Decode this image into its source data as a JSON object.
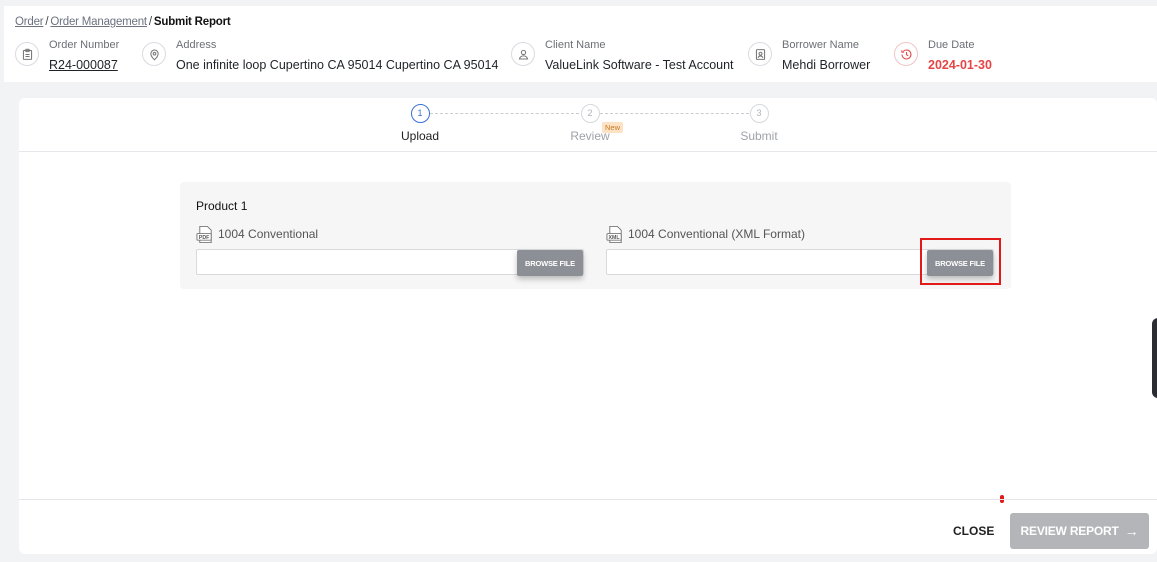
{
  "breadcrumb": {
    "items": [
      "Order",
      "Order Management"
    ],
    "separator": "/",
    "current": "Submit Report"
  },
  "order_info": {
    "order_number": {
      "label": "Order Number",
      "value": "R24-000087",
      "icon": "clipboard-icon"
    },
    "address": {
      "label": "Address",
      "value": "One infinite loop Cupertino CA 95014 Cupertino CA 95014",
      "icon": "location-pin-icon"
    },
    "client_name": {
      "label": "Client Name",
      "value": "ValueLink Software - Test Account",
      "icon": "user-icon"
    },
    "borrower_name": {
      "label": "Borrower Name",
      "value": "Mehdi Borrower",
      "icon": "id-badge-icon"
    },
    "due_date": {
      "label": "Due Date",
      "value": "2024-01-30",
      "icon": "clock-history-icon",
      "color": "#e64545"
    }
  },
  "stepper": {
    "steps": [
      {
        "number": "1",
        "label": "Upload",
        "active": true
      },
      {
        "number": "2",
        "label": "Review",
        "badge": "New"
      },
      {
        "number": "3",
        "label": "Submit"
      }
    ]
  },
  "product": {
    "title": "Product 1",
    "fields": [
      {
        "label": "1004 Conventional",
        "icon": "pdf-file-icon",
        "icon_text": "PDF",
        "button": "BROWSE FILE",
        "value": ""
      },
      {
        "label": "1004 Conventional (XML Format)",
        "icon": "xml-file-icon",
        "icon_text": "XML",
        "button": "BROWSE FILE",
        "value": ""
      }
    ]
  },
  "footer": {
    "close_label": "CLOSE",
    "review_label": "REVIEW REPORT",
    "review_arrow": "→"
  },
  "colors": {
    "accent": "#3b6fd4",
    "due_date": "#e64545",
    "highlight": "#e11919",
    "browse_button": "#8c8f95",
    "review_button_disabled": "#b3b5b9"
  }
}
